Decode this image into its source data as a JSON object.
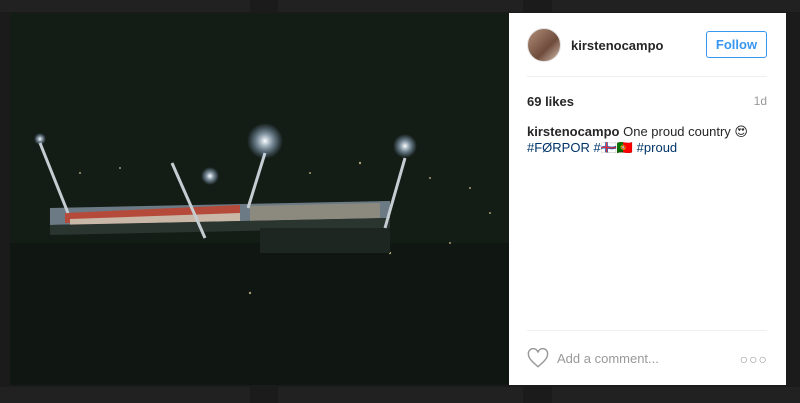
{
  "post": {
    "username": "kirstenocampo",
    "follow_label": "Follow",
    "likes": "69 likes",
    "age": "1d",
    "caption": {
      "username": "kirstenocampo",
      "text": " One proud country 😍",
      "tags_line": "#FØRPOR #🇫🇴🇵🇹 #proud"
    },
    "comment_placeholder": "Add a comment...",
    "more_label": "○○○"
  },
  "colors": {
    "accent": "#3897f0",
    "hashtag": "#003569",
    "muted": "#999999"
  }
}
